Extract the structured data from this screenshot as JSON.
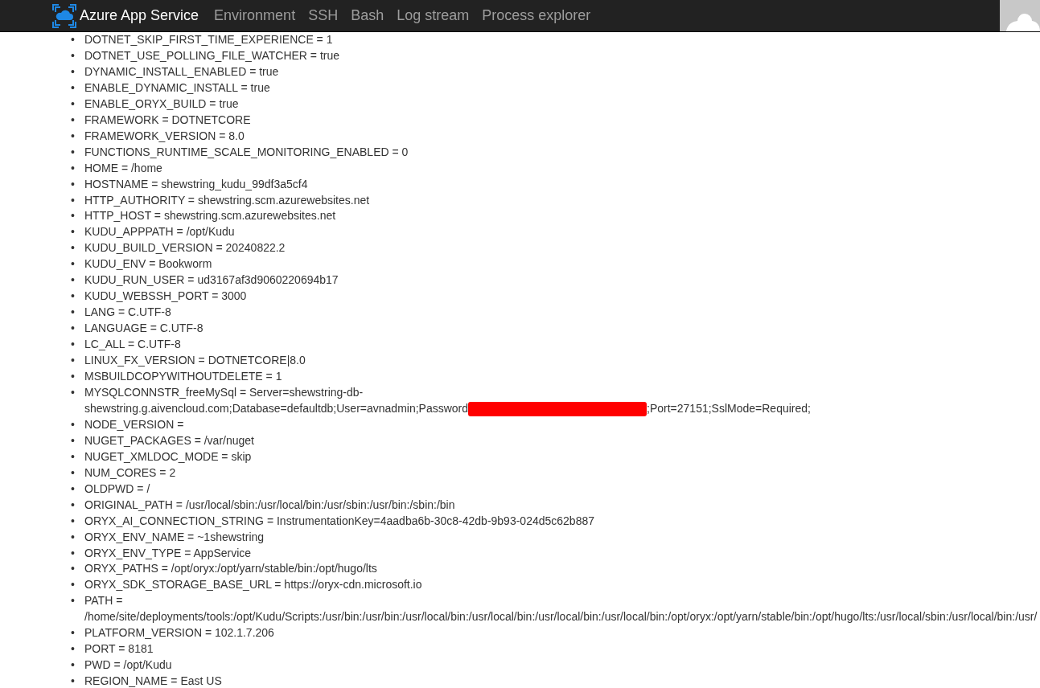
{
  "navbar": {
    "brand": "Azure App Service",
    "links": [
      {
        "label": "Environment"
      },
      {
        "label": "SSH"
      },
      {
        "label": "Bash"
      },
      {
        "label": "Log stream"
      },
      {
        "label": "Process explorer"
      }
    ]
  },
  "variables": [
    {
      "kind": "plain",
      "marker": "•",
      "text": "DOTNET_SKIP_FIRST_TIME_EXPERIENCE = 1"
    },
    {
      "kind": "plain",
      "marker": "•",
      "text": "DOTNET_USE_POLLING_FILE_WATCHER = true"
    },
    {
      "kind": "plain",
      "marker": "•",
      "text": "DYNAMIC_INSTALL_ENABLED = true"
    },
    {
      "kind": "plain",
      "marker": "•",
      "text": "ENABLE_DYNAMIC_INSTALL = true"
    },
    {
      "kind": "plain",
      "marker": "•",
      "text": "ENABLE_ORYX_BUILD = true"
    },
    {
      "kind": "plain",
      "marker": "•",
      "text": "FRAMEWORK = DOTNETCORE"
    },
    {
      "kind": "plain",
      "marker": "•",
      "text": "FRAMEWORK_VERSION = 8.0"
    },
    {
      "kind": "plain",
      "marker": "•",
      "text": "FUNCTIONS_RUNTIME_SCALE_MONITORING_ENABLED = 0"
    },
    {
      "kind": "plain",
      "marker": "•",
      "text": "HOME = /home"
    },
    {
      "kind": "plain",
      "marker": "•",
      "text": "HOSTNAME = shewstring_kudu_99df3a5cf4"
    },
    {
      "kind": "plain",
      "marker": "•",
      "text": "HTTP_AUTHORITY = shewstring.scm.azurewebsites.net"
    },
    {
      "kind": "plain",
      "marker": "•",
      "text": "HTTP_HOST = shewstring.scm.azurewebsites.net"
    },
    {
      "kind": "plain",
      "marker": "•",
      "text": "KUDU_APPPATH = /opt/Kudu"
    },
    {
      "kind": "plain",
      "marker": "•",
      "text": "KUDU_BUILD_VERSION = 20240822.2"
    },
    {
      "kind": "plain",
      "marker": "•",
      "text": "KUDU_ENV = Bookworm"
    },
    {
      "kind": "plain",
      "marker": "•",
      "text": "KUDU_RUN_USER = ud3167af3d9060220694b17"
    },
    {
      "kind": "plain",
      "marker": "•",
      "text": "KUDU_WEBSSH_PORT = 3000"
    },
    {
      "kind": "plain",
      "marker": "•",
      "text": "LANG = C.UTF-8"
    },
    {
      "kind": "plain",
      "marker": "•",
      "text": "LANGUAGE = C.UTF-8"
    },
    {
      "kind": "plain",
      "marker": "•",
      "text": "LC_ALL = C.UTF-8"
    },
    {
      "kind": "plain",
      "marker": "•",
      "text": "LINUX_FX_VERSION = DOTNETCORE|8.0"
    },
    {
      "kind": "plain",
      "marker": "•",
      "text": "MSBUILDCOPYWITHOUTDELETE = 1"
    },
    {
      "kind": "redacted",
      "marker": "•",
      "text": "MYSQLCONNSTR_freeMySql = Server=shewstring-db-",
      "continuation": "shewstring.g.aivencloud.com;Database=defaultdb;User=avnadmin;Password",
      "after": ";Port=27151;SslMode=Required;"
    },
    {
      "kind": "plain",
      "marker": "•",
      "text": "NODE_VERSION ="
    },
    {
      "kind": "plain",
      "marker": "•",
      "text": "NUGET_PACKAGES = /var/nuget"
    },
    {
      "kind": "plain",
      "marker": "•",
      "text": "NUGET_XMLDOC_MODE = skip"
    },
    {
      "kind": "plain",
      "marker": "•",
      "text": "NUM_CORES = 2"
    },
    {
      "kind": "plain",
      "marker": "•",
      "text": "OLDPWD = /"
    },
    {
      "kind": "plain",
      "marker": "•",
      "text": "ORIGINAL_PATH = /usr/local/sbin:/usr/local/bin:/usr/sbin:/usr/bin:/sbin:/bin"
    },
    {
      "kind": "plain",
      "marker": "•",
      "text": "ORYX_AI_CONNECTION_STRING = InstrumentationKey=4aadba6b-30c8-42db-9b93-024d5c62b887"
    },
    {
      "kind": "plain",
      "marker": "•",
      "text": "ORYX_ENV_NAME = ~1shewstring"
    },
    {
      "kind": "plain",
      "marker": "•",
      "text": "ORYX_ENV_TYPE = AppService"
    },
    {
      "kind": "plain",
      "marker": "•",
      "text": "ORYX_PATHS = /opt/oryx:/opt/yarn/stable/bin:/opt/hugo/lts"
    },
    {
      "kind": "plain",
      "marker": "•",
      "text": "ORYX_SDK_STORAGE_BASE_URL = https://oryx-cdn.microsoft.io"
    },
    {
      "kind": "plain",
      "marker": "•",
      "text": "PATH = /home/site/deployments/tools:/opt/Kudu/Scripts:/usr/bin:/usr/bin:/usr/local/bin:/usr/local/bin:/usr/local/bin:/usr/local/bin:/opt/oryx:/opt/yarn/stable/bin:/opt/hugo/lts:/usr/local/sbin:/usr/local/bin:/usr/"
    },
    {
      "kind": "plain",
      "marker": "•",
      "text": "PLATFORM_VERSION = 102.1.7.206"
    },
    {
      "kind": "plain",
      "marker": "•",
      "text": "PORT = 8181"
    },
    {
      "kind": "plain",
      "marker": "•",
      "text": "PWD = /opt/Kudu"
    },
    {
      "kind": "plain",
      "marker": "•",
      "text": "REGION_NAME = East US"
    }
  ]
}
